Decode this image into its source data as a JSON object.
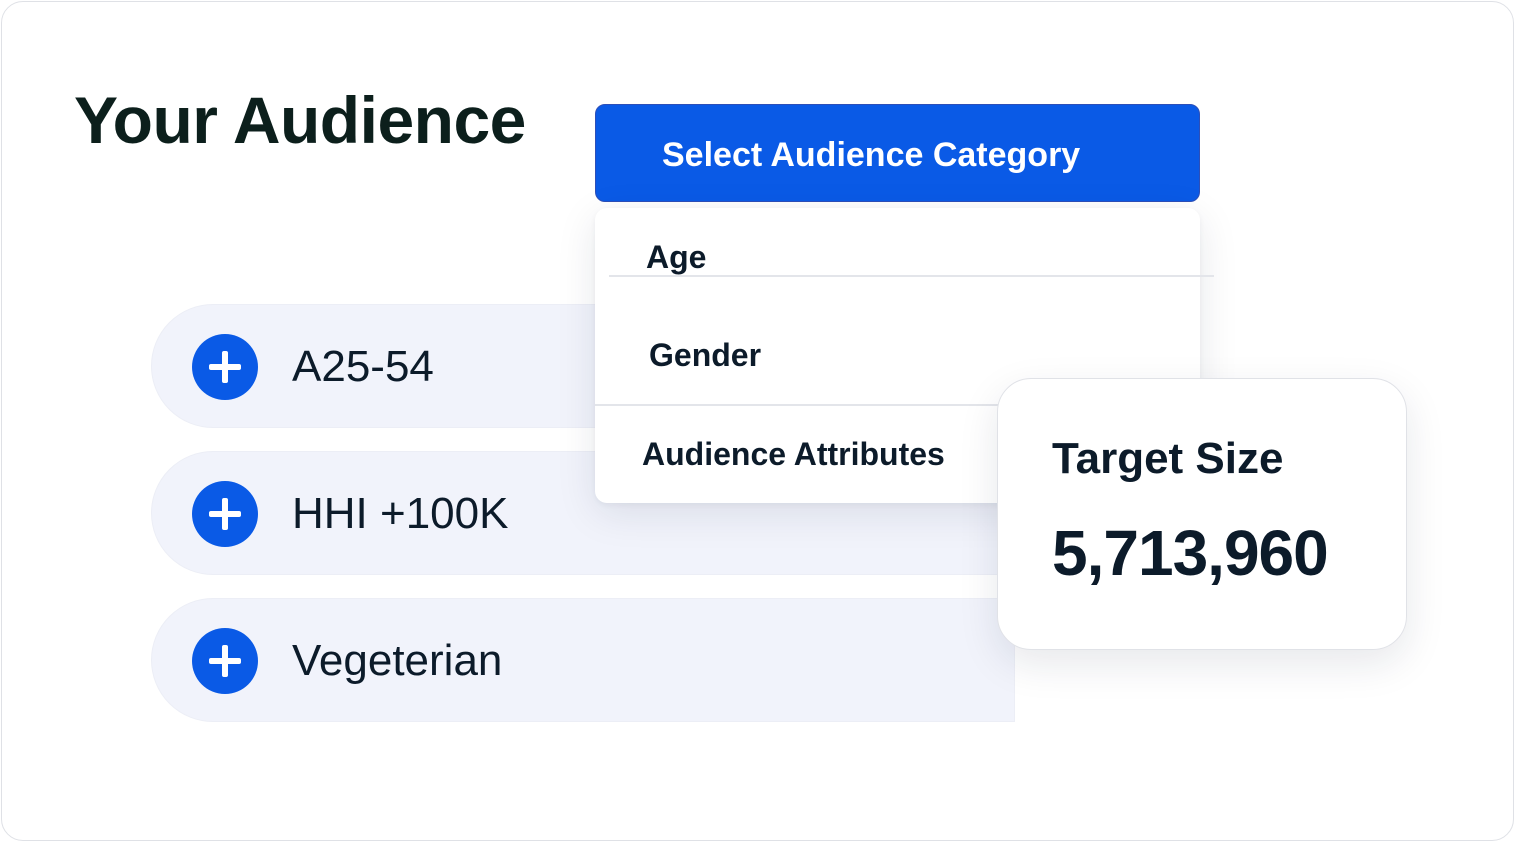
{
  "page": {
    "title": "Your Audience"
  },
  "selected_segments": [
    {
      "label": "A25-54",
      "icon": "plus-icon"
    },
    {
      "label": "HHI +100K",
      "icon": "plus-icon"
    },
    {
      "label": "Vegeterian",
      "icon": "plus-icon"
    }
  ],
  "category_dropdown": {
    "button_label": "Select Audience Category",
    "options": [
      "Age",
      "Gender",
      "Audience Attributes"
    ]
  },
  "target": {
    "title": "Target Size",
    "value": "5,713,960"
  },
  "colors": {
    "accent": "#0a5ae6",
    "chip_background": "#f1f3fb",
    "text": "#0c1b2a"
  }
}
